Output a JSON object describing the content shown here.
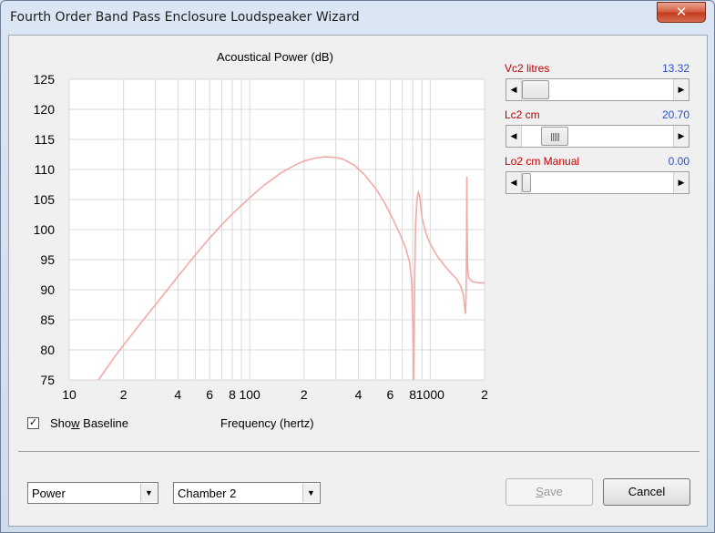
{
  "window": {
    "title": "Fourth Order Band Pass Enclosure Loudspeaker Wizard",
    "close_icon": "close-icon",
    "close_glyph": "✕"
  },
  "chart_data": {
    "type": "line",
    "title": "Acoustical Power (dB)",
    "xlabel": "Frequency (hertz)",
    "ylabel": "",
    "xscale": "log",
    "xlim": [
      10,
      2000
    ],
    "ylim": [
      75,
      125
    ],
    "grid": true,
    "y_ticks": [
      125,
      120,
      115,
      110,
      105,
      100,
      95,
      90,
      85,
      80,
      75
    ],
    "x_tick_labels": [
      {
        "value": 10,
        "label": "10"
      },
      {
        "value": 20,
        "label": "2"
      },
      {
        "value": 40,
        "label": "4"
      },
      {
        "value": 60,
        "label": "6"
      },
      {
        "value": 80,
        "label": "8"
      },
      {
        "value": 100,
        "label": "100"
      },
      {
        "value": 200,
        "label": "2"
      },
      {
        "value": 400,
        "label": "4"
      },
      {
        "value": 600,
        "label": "6"
      },
      {
        "value": 800,
        "label": "8"
      },
      {
        "value": 1000,
        "label": "1000"
      },
      {
        "value": 2000,
        "label": "2"
      }
    ],
    "series": [
      {
        "color": "#f2aaa6",
        "points": [
          [
            14.5,
            75
          ],
          [
            16,
            76.8
          ],
          [
            18,
            79
          ],
          [
            20,
            80.8
          ],
          [
            25,
            84.5
          ],
          [
            30,
            87.5
          ],
          [
            35,
            90
          ],
          [
            40,
            92.2
          ],
          [
            50,
            95.8
          ],
          [
            60,
            98.6
          ],
          [
            70,
            100.8
          ],
          [
            80,
            102.6
          ],
          [
            100,
            105.3
          ],
          [
            120,
            107.4
          ],
          [
            150,
            109.5
          ],
          [
            180,
            110.8
          ],
          [
            200,
            111.4
          ],
          [
            230,
            111.9
          ],
          [
            260,
            112.1
          ],
          [
            300,
            112.0
          ],
          [
            330,
            111.7
          ],
          [
            380,
            110.7
          ],
          [
            430,
            109.2
          ],
          [
            500,
            106.8
          ],
          [
            560,
            104.4
          ],
          [
            620,
            101.8
          ],
          [
            680,
            99.2
          ],
          [
            730,
            97
          ],
          [
            770,
            94.5
          ],
          [
            790,
            91
          ],
          [
            800,
            85
          ],
          [
            810,
            75
          ],
          [
            820,
            92
          ],
          [
            830,
            101
          ],
          [
            845,
            105
          ],
          [
            860,
            106.2
          ],
          [
            875,
            105.5
          ],
          [
            900,
            102
          ],
          [
            950,
            99.3
          ],
          [
            1000,
            97.6
          ],
          [
            1100,
            95.5
          ],
          [
            1200,
            94
          ],
          [
            1300,
            92.8
          ],
          [
            1400,
            91.8
          ],
          [
            1480,
            90.5
          ],
          [
            1530,
            89
          ],
          [
            1555,
            87
          ],
          [
            1570,
            86
          ],
          [
            1582,
            90
          ],
          [
            1590,
            100
          ],
          [
            1595,
            108.8
          ],
          [
            1600,
            102
          ],
          [
            1610,
            94
          ],
          [
            1630,
            92
          ],
          [
            1700,
            91.4
          ],
          [
            1800,
            91.2
          ],
          [
            2000,
            91.1
          ]
        ]
      }
    ]
  },
  "sliders": [
    {
      "label": "Vc2  litres",
      "value": "13.32",
      "position": 0.0
    },
    {
      "label": "Lc2  cm",
      "value": "20.70",
      "position": 0.13
    },
    {
      "label": "Lo2  cm  Manual",
      "value": "0.00",
      "position": 0.0
    }
  ],
  "baseline": {
    "label_prefix": "Sho",
    "label_accel": "w",
    "label_suffix": " Baseline",
    "checked": true,
    "check_glyph": "✓"
  },
  "combos": [
    {
      "value": "Power",
      "arrow_glyph": "▼"
    },
    {
      "value": "Chamber 2",
      "arrow_glyph": "▼"
    }
  ],
  "buttons": {
    "save_accel": "S",
    "save_rest": "ave",
    "cancel": "Cancel"
  },
  "glyphs": {
    "left": "◀",
    "right": "▶"
  }
}
